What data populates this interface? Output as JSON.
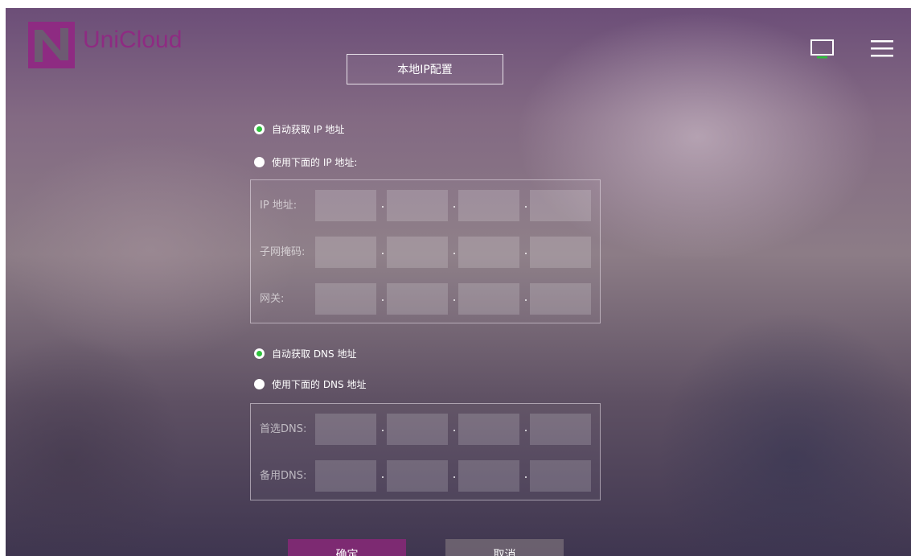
{
  "brand": {
    "name": "UniCloud",
    "color": "#8e2b82"
  },
  "header": {
    "title": "本地IP配置",
    "icons": [
      "display-icon",
      "menu-icon"
    ]
  },
  "ip": {
    "auto_label": "自动获取 IP 地址",
    "manual_label": "使用下面的 IP 地址:",
    "mode": "auto",
    "fields": [
      {
        "label": "IP 地址:"
      },
      {
        "label": "子网掩码:"
      },
      {
        "label": "网关:"
      }
    ]
  },
  "dns": {
    "auto_label": "自动获取 DNS 地址",
    "manual_label": "使用下面的 DNS 地址",
    "mode": "auto",
    "fields": [
      {
        "label": "首选DNS:"
      },
      {
        "label": "备用DNS:"
      }
    ]
  },
  "buttons": {
    "confirm": "确定",
    "cancel": "取消"
  },
  "colors": {
    "accent": "#7d2a72",
    "radio_checked": "#2ec13c"
  }
}
